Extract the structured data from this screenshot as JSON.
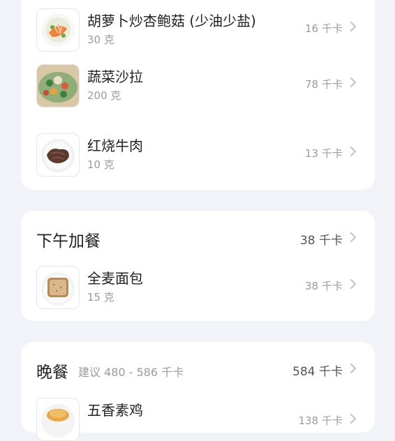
{
  "lunch": {
    "items": [
      {
        "name": "胡萝卜炒杏鲍菇 (少油少盐)",
        "qty": "30 克",
        "kcal": "16 千卡",
        "icon": "carrot-mushroom-dish-icon"
      },
      {
        "name": "蔬菜沙拉",
        "qty": "200 克",
        "kcal": "78 千卡",
        "icon": "vegetable-salad-icon"
      },
      {
        "name": "红烧牛肉",
        "qty": "10 克",
        "kcal": "13 千卡",
        "icon": "braised-beef-icon"
      }
    ]
  },
  "snack": {
    "title": "下午加餐",
    "kcal": "38 千卡",
    "items": [
      {
        "name": "全麦面包",
        "qty": "15 克",
        "kcal": "38 千卡",
        "icon": "whole-wheat-bread-icon"
      }
    ]
  },
  "dinner": {
    "title": "晚餐",
    "suggestion": "建议 480 - 586 千卡",
    "kcal": "584 千卡",
    "items": [
      {
        "name": "五香素鸡",
        "qty": "",
        "kcal": "138 千卡",
        "icon": "five-spice-tofu-icon"
      }
    ]
  },
  "colors": {
    "background": "#f2f3f8",
    "card": "#ffffff",
    "muted": "#9a9aa2"
  }
}
